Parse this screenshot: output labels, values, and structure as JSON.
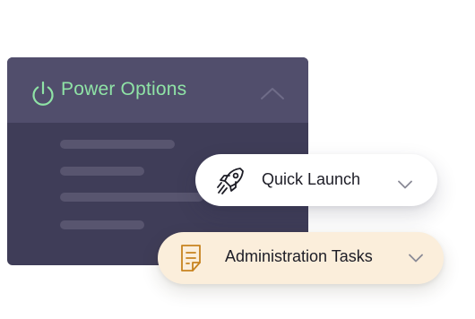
{
  "power_panel": {
    "title": "Power Options",
    "title_color": "#8fe3a6",
    "icon": "power-icon",
    "toggle_icon": "chevron-up-icon",
    "expanded": true
  },
  "quick_launch": {
    "label": "Quick Launch",
    "icon": "rocket-icon",
    "toggle_icon": "chevron-down-icon"
  },
  "administration_tasks": {
    "label": "Administration Tasks",
    "icon": "document-icon",
    "toggle_icon": "chevron-down-icon",
    "accent": "#c7831f",
    "background": "#fbeedb"
  }
}
